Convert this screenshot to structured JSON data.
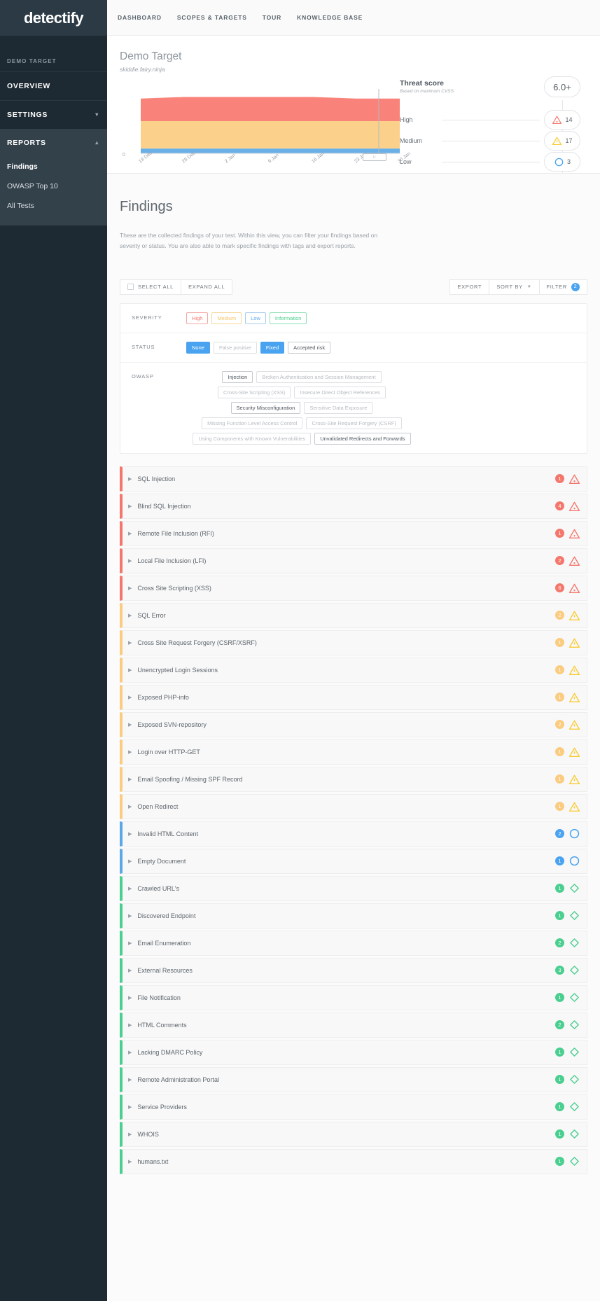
{
  "brand": {
    "logo": "detectify"
  },
  "topnav": {
    "items": [
      {
        "label": "DASHBOARD"
      },
      {
        "label": "SCOPES & TARGETS"
      },
      {
        "label": "TOUR"
      },
      {
        "label": "KNOWLEDGE BASE"
      }
    ]
  },
  "sidebar": {
    "section_label": "DEMO TARGET",
    "items": [
      {
        "label": "OVERVIEW",
        "chevron": ""
      },
      {
        "label": "SETTINGS",
        "chevron": "▾"
      },
      {
        "label": "REPORTS",
        "chevron": "▴"
      }
    ],
    "sub_items": [
      {
        "label": "Findings"
      },
      {
        "label": "OWASP Top 10"
      },
      {
        "label": "All Tests"
      }
    ]
  },
  "header": {
    "target_title": "Demo Target",
    "target_domain": "skiddie.fairy.ninja",
    "y_zero": "0",
    "scrub_handle": "∶∶"
  },
  "threat": {
    "title": "Threat score",
    "subtitle": "Based on maximum CVSS",
    "score": "6.0+",
    "rows": [
      {
        "name": "High",
        "count": "14",
        "icon": "triangle-alert-icon",
        "color": "#f4776c"
      },
      {
        "name": "Medium",
        "count": "17",
        "icon": "triangle-alert-icon",
        "color": "#fbcb33"
      },
      {
        "name": "Low",
        "count": "3",
        "icon": "circle-icon",
        "color": "#4aa3f0"
      }
    ]
  },
  "chart_data": {
    "type": "area",
    "title": "",
    "xlabel": "",
    "ylabel": "",
    "grid": false,
    "legend": "none",
    "ylim": [
      0,
      40
    ],
    "categories": [
      "19 Dec",
      "26 Dec",
      "2 Jan",
      "9 Jan",
      "16 Jan",
      "23 Jan",
      "30 Jan"
    ],
    "x": [
      0,
      1,
      2,
      3,
      4,
      5,
      6
    ],
    "series": [
      {
        "name": "High",
        "color": "#f9837a",
        "values": [
          14,
          15,
          15,
          15,
          15,
          14,
          14
        ]
      },
      {
        "name": "Medium",
        "color": "#fbd08a",
        "values": [
          17,
          17,
          17,
          17,
          17,
          17,
          17
        ]
      },
      {
        "name": "Low",
        "color": "#6ab0e8",
        "values": [
          3,
          3,
          3,
          3,
          3,
          3,
          3
        ]
      }
    ]
  },
  "findings": {
    "title": "Findings",
    "description": "These are the collected findings of your test. Within this view, you can filter your findings based on severity or status. You are also able to mark specific findings with tags and export reports."
  },
  "toolbar": {
    "select_all": "SELECT ALL",
    "expand_all": "EXPAND ALL",
    "export": "EXPORT",
    "sort_by": "SORT BY",
    "filter": "FILTER",
    "filter_count": "2"
  },
  "filters": {
    "severity_label": "SEVERITY",
    "severity_chips": [
      {
        "label": "High",
        "style": "sev-high"
      },
      {
        "label": "Medium",
        "style": "sev-med"
      },
      {
        "label": "Low",
        "style": "sev-low"
      },
      {
        "label": "Information",
        "style": "sev-info"
      }
    ],
    "status_label": "STATUS",
    "status_chips": [
      {
        "label": "None",
        "style": "solid-blue"
      },
      {
        "label": "False positive",
        "style": ""
      },
      {
        "label": "Fixed",
        "style": "solid-blue"
      },
      {
        "label": "Accepted risk",
        "style": "on-dark"
      }
    ],
    "owasp_label": "OWASP",
    "owasp_chips": [
      {
        "label": "Injection",
        "style": "on-dark"
      },
      {
        "label": "Broken Authentication and Session Management",
        "style": ""
      },
      {
        "label": "Cross-Site Scripting (XSS)",
        "style": ""
      },
      {
        "label": "Insecure Direct Object References",
        "style": ""
      },
      {
        "label": "Security Misconfiguration",
        "style": "on-dark"
      },
      {
        "label": "Sensitive Data Exposure",
        "style": ""
      },
      {
        "label": "Missing Function Level Access Control",
        "style": ""
      },
      {
        "label": "Cross-Site Request Forgery (CSRF)",
        "style": ""
      },
      {
        "label": "Using Components with Known Vulnerabilities",
        "style": ""
      },
      {
        "label": "Unvalidated Redirects and Forwards",
        "style": "on-dark"
      }
    ]
  },
  "finding_rows": [
    {
      "name": "SQL Injection",
      "count": "1",
      "level": "high"
    },
    {
      "name": "Blind SQL Injection",
      "count": "4",
      "level": "high"
    },
    {
      "name": "Remote File Inclusion (RFI)",
      "count": "1",
      "level": "high"
    },
    {
      "name": "Local File Inclusion (LFI)",
      "count": "2",
      "level": "high"
    },
    {
      "name": "Cross Site Scripting (XSS)",
      "count": "6",
      "level": "high"
    },
    {
      "name": "SQL Error",
      "count": "2",
      "level": "medium"
    },
    {
      "name": "Cross Site Request Forgery (CSRF/XSRF)",
      "count": "1",
      "level": "medium"
    },
    {
      "name": "Unencrypted Login Sessions",
      "count": "1",
      "level": "medium"
    },
    {
      "name": "Exposed PHP-info",
      "count": "1",
      "level": "medium"
    },
    {
      "name": "Exposed SVN-repository",
      "count": "2",
      "level": "medium"
    },
    {
      "name": "Login over HTTP-GET",
      "count": "1",
      "level": "medium"
    },
    {
      "name": "Email Spoofing / Missing SPF Record",
      "count": "1",
      "level": "medium"
    },
    {
      "name": "Open Redirect",
      "count": "1",
      "level": "medium"
    },
    {
      "name": "Invalid HTML Content",
      "count": "2",
      "level": "low"
    },
    {
      "name": "Empty Document",
      "count": "1",
      "level": "low"
    },
    {
      "name": "Crawled URL's",
      "count": "1",
      "level": "info"
    },
    {
      "name": "Discovered Endpoint",
      "count": "1",
      "level": "info"
    },
    {
      "name": "Email Enumeration",
      "count": "2",
      "level": "info"
    },
    {
      "name": "External Resources",
      "count": "3",
      "level": "info"
    },
    {
      "name": "File Notification",
      "count": "1",
      "level": "info"
    },
    {
      "name": "HTML Comments",
      "count": "2",
      "level": "info"
    },
    {
      "name": "Lacking DMARC Policy",
      "count": "1",
      "level": "info"
    },
    {
      "name": "Remote Administration Portal",
      "count": "1",
      "level": "info"
    },
    {
      "name": "Service Providers",
      "count": "1",
      "level": "info"
    },
    {
      "name": "WHOIS",
      "count": "1",
      "level": "info"
    },
    {
      "name": "humans.txt",
      "count": "1",
      "level": "info"
    }
  ]
}
